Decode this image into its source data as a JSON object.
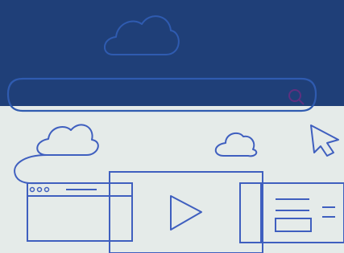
{
  "colors": {
    "navy": "#1f3f78",
    "light_bg": "#e5ebe9",
    "line_on_navy": "#2f5bb0",
    "line_on_light": "#3f5fbf",
    "search_icon": "#5f2f7f"
  },
  "icons": {
    "top_cloud": "cloud-icon",
    "left_cloud": "cloud-icon",
    "right_cloud": "cloud-icon",
    "cursor": "arrow-cursor-icon",
    "play": "play-icon",
    "search": "search-icon"
  }
}
